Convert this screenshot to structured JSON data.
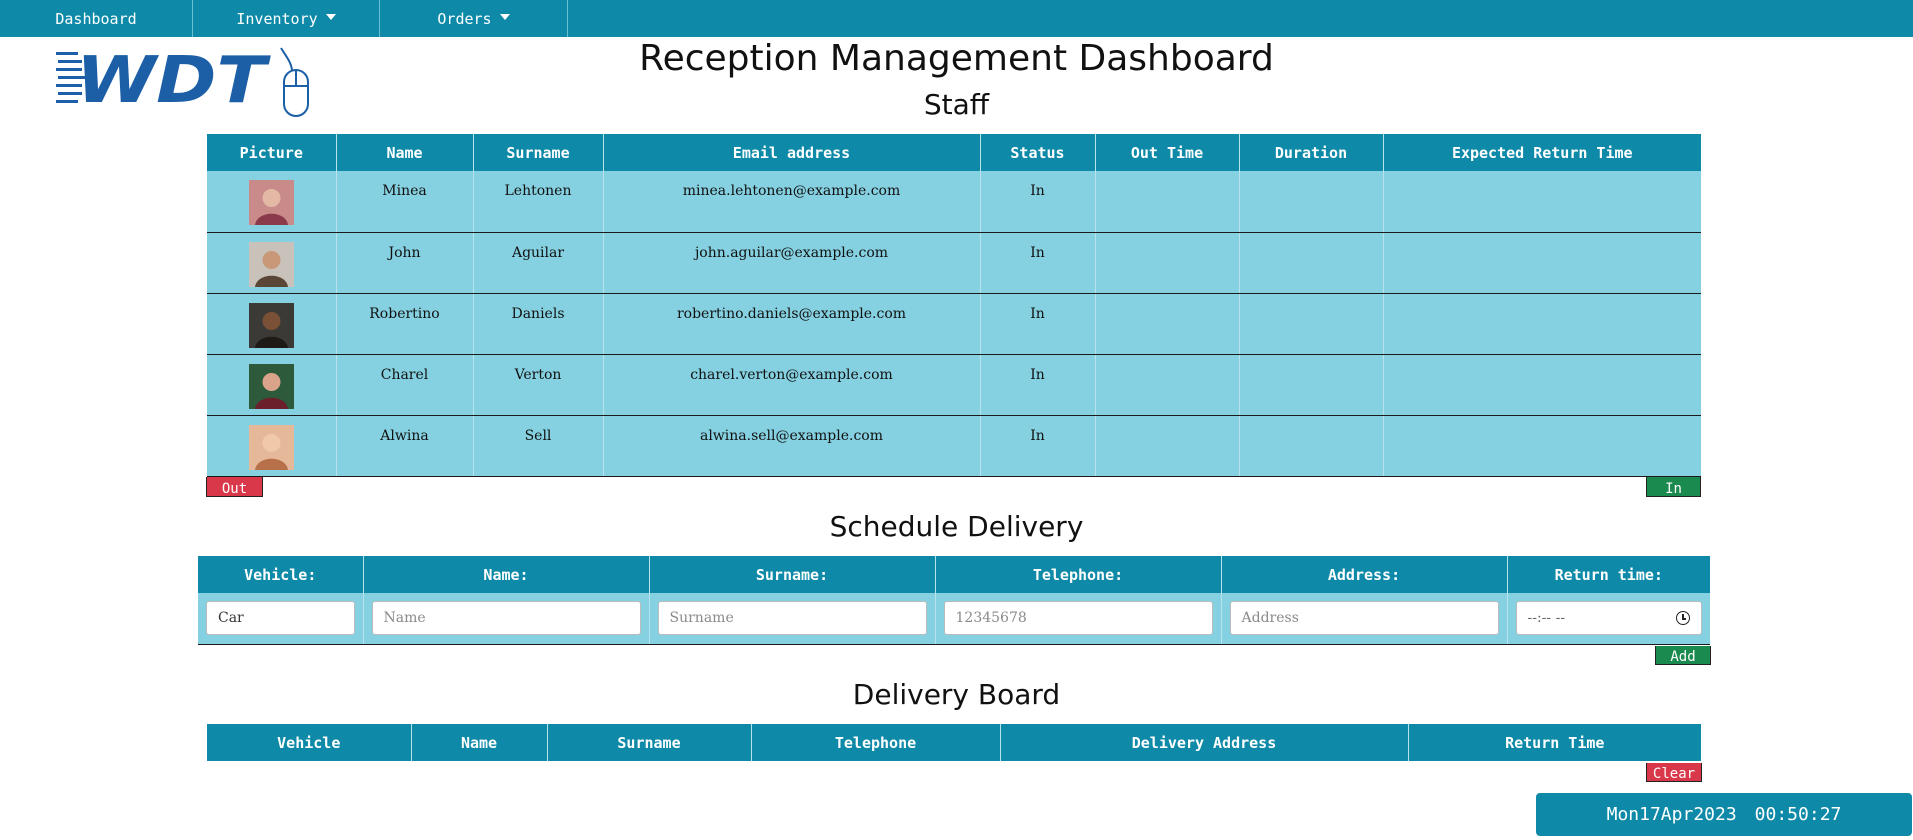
{
  "nav": {
    "dashboard": "Dashboard",
    "inventory": "Inventory",
    "orders": "Orders"
  },
  "logo": {
    "text": "WDT"
  },
  "page_title": "Reception Management Dashboard",
  "staff": {
    "title": "Staff",
    "headers": [
      "Picture",
      "Name",
      "Surname",
      "Email address",
      "Status",
      "Out Time",
      "Duration",
      "Expected Return Time"
    ],
    "rows": [
      {
        "name": "Minea",
        "surname": "Lehtonen",
        "email": "minea.lehtonen@example.com",
        "status": "In",
        "out_time": "",
        "duration": "",
        "return_time": "",
        "avatar_colors": [
          "#c98a8a",
          "#e3b9a5",
          "#8a3a4a"
        ]
      },
      {
        "name": "John",
        "surname": "Aguilar",
        "email": "john.aguilar@example.com",
        "status": "In",
        "out_time": "",
        "duration": "",
        "return_time": "",
        "avatar_colors": [
          "#c8c2ba",
          "#c99878",
          "#5a4636"
        ]
      },
      {
        "name": "Robertino",
        "surname": "Daniels",
        "email": "robertino.daniels@example.com",
        "status": "In",
        "out_time": "",
        "duration": "",
        "return_time": "",
        "avatar_colors": [
          "#3c3a36",
          "#7a5136",
          "#1e1a16"
        ]
      },
      {
        "name": "Charel",
        "surname": "Verton",
        "email": "charel.verton@example.com",
        "status": "In",
        "out_time": "",
        "duration": "",
        "return_time": "",
        "avatar_colors": [
          "#2e5a3c",
          "#d9a48a",
          "#6a1f2a"
        ]
      },
      {
        "name": "Alwina",
        "surname": "Sell",
        "email": "alwina.sell@example.com",
        "status": "In",
        "out_time": "",
        "duration": "",
        "return_time": "",
        "avatar_colors": [
          "#e6b89a",
          "#f0c8aa",
          "#b8704a"
        ]
      }
    ],
    "out_button": "Out",
    "in_button": "In"
  },
  "schedule": {
    "title": "Schedule Delivery",
    "headers": [
      "Vehicle:",
      "Name:",
      "Surname:",
      "Telephone:",
      "Address:",
      "Return time:"
    ],
    "vehicle_value": "Car",
    "name_placeholder": "Name",
    "surname_placeholder": "Surname",
    "telephone_placeholder": "12345678",
    "address_placeholder": "Address",
    "return_time_placeholder": "--:-- --",
    "add_button": "Add"
  },
  "board": {
    "title": "Delivery Board",
    "headers": [
      "Vehicle",
      "Name",
      "Surname",
      "Telephone",
      "Delivery Address",
      "Return Time"
    ],
    "clear_button": "Clear"
  },
  "clock": {
    "date": "Mon17Apr2023",
    "time": "00:50:27"
  },
  "colors": {
    "primary": "#0e8aa8",
    "row_bg": "#85d1e1",
    "danger": "#d9384a",
    "success": "#1b8a4f",
    "logo_blue": "#1c5fa6"
  }
}
